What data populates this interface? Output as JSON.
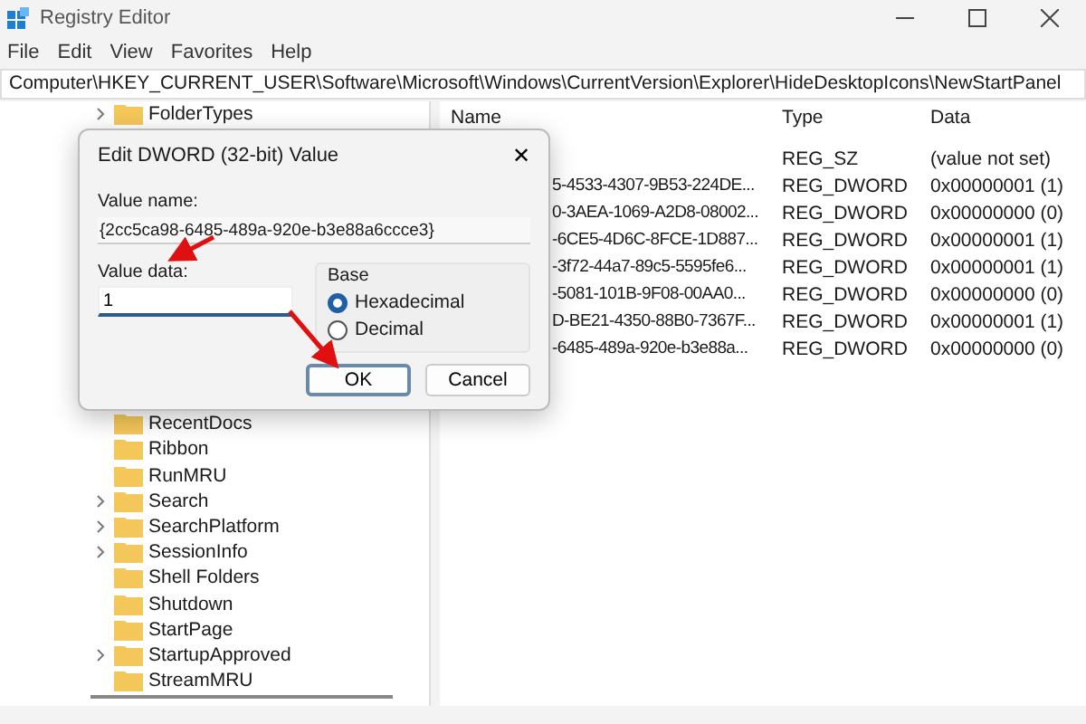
{
  "window": {
    "title": "Registry Editor"
  },
  "menu": [
    "File",
    "Edit",
    "View",
    "Favorites",
    "Help"
  ],
  "address": "Computer\\HKEY_CURRENT_USER\\Software\\Microsoft\\Windows\\CurrentVersion\\Explorer\\HideDesktopIcons\\NewStartPanel",
  "tree": {
    "items": [
      {
        "label": "FolderTypes",
        "expandable": true
      },
      {
        "label": "RecentDocs",
        "expandable": false
      },
      {
        "label": "Ribbon",
        "expandable": false
      },
      {
        "label": "RunMRU",
        "expandable": false
      },
      {
        "label": "Search",
        "expandable": true
      },
      {
        "label": "SearchPlatform",
        "expandable": true
      },
      {
        "label": "SessionInfo",
        "expandable": true
      },
      {
        "label": "Shell Folders",
        "expandable": false
      },
      {
        "label": "Shutdown",
        "expandable": false
      },
      {
        "label": "StartPage",
        "expandable": false
      },
      {
        "label": "StartupApproved",
        "expandable": true
      },
      {
        "label": "StreamMRU",
        "expandable": false
      }
    ]
  },
  "table": {
    "columns": [
      "Name",
      "Type",
      "Data"
    ],
    "rows": [
      {
        "name": "",
        "type": "REG_SZ",
        "data": "(value not set)"
      },
      {
        "name": "5-4533-4307-9B53-224DE...",
        "type": "REG_DWORD",
        "data": "0x00000001 (1)"
      },
      {
        "name": "0-3AEA-1069-A2D8-08002...",
        "type": "REG_DWORD",
        "data": "0x00000000 (0)"
      },
      {
        "name": "-6CE5-4D6C-8FCE-1D887...",
        "type": "REG_DWORD",
        "data": "0x00000001 (1)"
      },
      {
        "name": "-3f72-44a7-89c5-5595fe6...",
        "type": "REG_DWORD",
        "data": "0x00000001 (1)"
      },
      {
        "name": "-5081-101B-9F08-00AA0...",
        "type": "REG_DWORD",
        "data": "0x00000000 (0)"
      },
      {
        "name": "D-BE21-4350-88B0-7367F...",
        "type": "REG_DWORD",
        "data": "0x00000001 (1)"
      },
      {
        "name": "-6485-489a-920e-b3e88a...",
        "type": "REG_DWORD",
        "data": "0x00000000 (0)"
      }
    ]
  },
  "dialog": {
    "title": "Edit DWORD (32-bit) Value",
    "close": "✕",
    "value_name_label": "Value name:",
    "value_name": "{2cc5ca98-6485-489a-920e-b3e88a6ccce3}",
    "value_data_label": "Value data:",
    "value_data": "1",
    "base_label": "Base",
    "base_options": [
      {
        "label": "Hexadecimal",
        "selected": true
      },
      {
        "label": "Decimal",
        "selected": false
      }
    ],
    "buttons": [
      {
        "label": "OK",
        "focused": true
      },
      {
        "label": "Cancel",
        "focused": false
      }
    ]
  }
}
